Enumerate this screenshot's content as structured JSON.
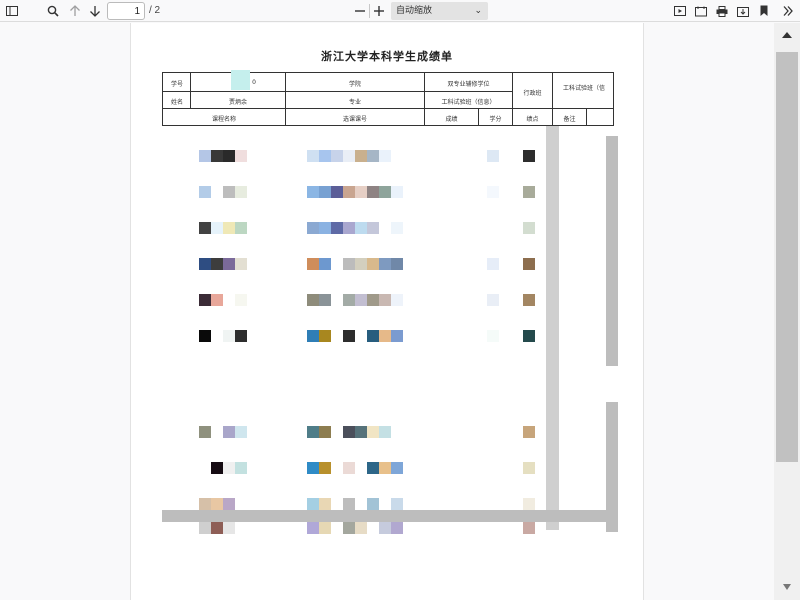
{
  "toolbar": {
    "sidebar_icon": "sidebar-toggle-icon",
    "search_icon": "search-icon",
    "prev_icon": "arrow-up-icon",
    "next_icon": "arrow-down-icon",
    "page_number": "1",
    "page_total": "/ 2",
    "zoom_out_icon": "minus-icon",
    "zoom_in_icon": "plus-icon",
    "zoom_value": "自动缩放",
    "right_icons": [
      "presentation-icon",
      "open-file-icon",
      "print-icon",
      "download-icon",
      "bookmark-icon",
      "double-chevron-icon"
    ]
  },
  "document": {
    "title": "浙江大学本科学生成绩单",
    "header": {
      "student_id_label": "学号",
      "student_id_suffix": "0",
      "college_label": "学院",
      "double_major_label": "双专业辅修学位",
      "admin_class_label": "行政班",
      "engineering_class_label": "工科试验班（信",
      "name_label": "姓名",
      "name_value": "贾炳余",
      "major_label": "专业",
      "engineering_label": "工科试验班（信息）",
      "col_course_name": "课程名称",
      "col_course_code": "选课课号",
      "col_score": "成绩",
      "col_credit": "学分",
      "col_gpa": "绩点",
      "col_remark": "备注"
    }
  },
  "colors": {
    "toolbar_bg": "#f9f9fa",
    "viewer_bg": "#f9f9fa",
    "page_bg": "#ffffff",
    "scrollbar_thumb": "#c1c1c1",
    "redaction_gray": "#bdbdbd"
  }
}
